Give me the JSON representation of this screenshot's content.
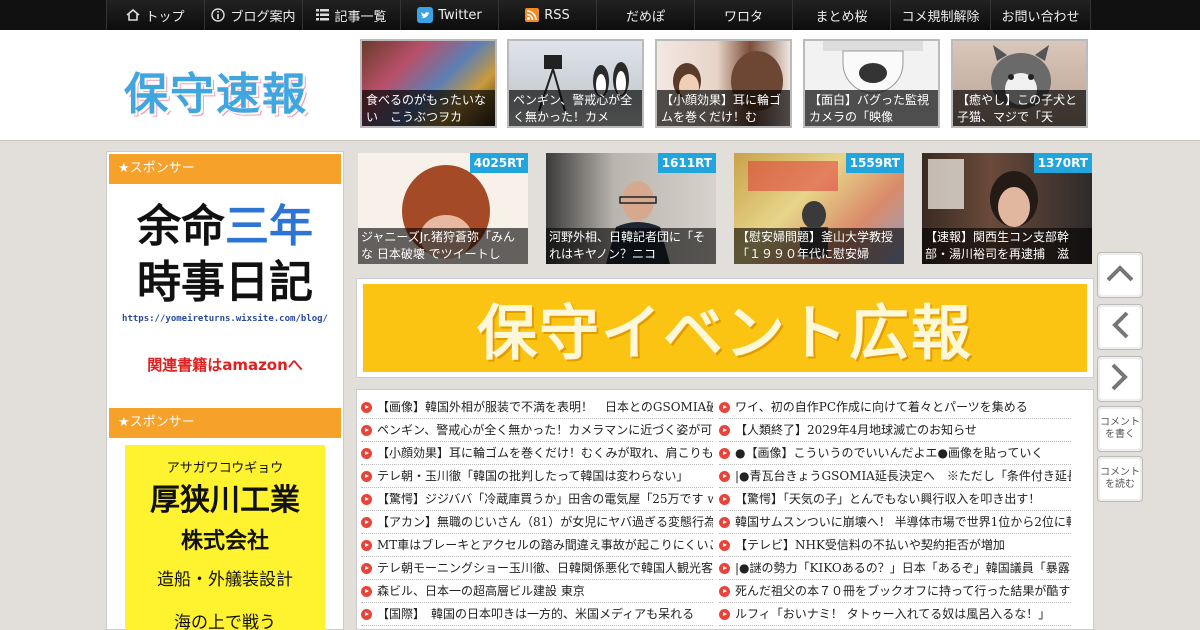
{
  "nav": {
    "items": [
      {
        "label": "トップ",
        "icon": "home-icon"
      },
      {
        "label": "ブログ案内",
        "icon": "info-icon"
      },
      {
        "label": "記事一覧",
        "icon": "list-icon"
      },
      {
        "label": "Twitter",
        "icon": "twitter-icon"
      },
      {
        "label": "RSS",
        "icon": "rss-icon"
      },
      {
        "label": "だめぽ"
      },
      {
        "label": "ワロタ"
      },
      {
        "label": "まとめ桜"
      },
      {
        "label": "コメ規制解除"
      },
      {
        "label": "お問い合わせ"
      }
    ]
  },
  "header": {
    "logo": "保守速報",
    "thumbs": [
      {
        "caption": "食べるのがもったいない　こうぶつヲカ"
      },
      {
        "caption": "ペンギン、警戒心が全く無かった！カメ"
      },
      {
        "caption": "【小顔効果】耳に輪ゴムを巻くだけ！む"
      },
      {
        "caption": "【面白】バグった監視カメラの「映像"
      },
      {
        "caption": "【癒やし】この子犬と子猫、マジで「天"
      }
    ]
  },
  "sidebar": {
    "sponsor_title": "★スポンサー",
    "ad1": {
      "line1a": "余命",
      "line1b": "三年",
      "line2": "時事日記",
      "url": "https://yomeireturns.wixsite.com/blog/",
      "amazon": "関連書籍はamazonへ"
    },
    "sponsor_title2": "★スポンサー",
    "ad2": {
      "kana": "アサガワコウギョウ",
      "name": "厚狭川工業",
      "company": "株式会社",
      "business": "造船・外艤装設計",
      "motto": "海の上で戦う"
    }
  },
  "rt_cards": [
    {
      "rt": "4025RT",
      "caption": "ジャニーズJr.猪狩蒼弥「みんな 日本破壊 でツイートし"
    },
    {
      "rt": "1611RT",
      "caption": "河野外相、日韓記者団に「それはキヤノン？ニコ"
    },
    {
      "rt": "1559RT",
      "caption": "【慰安婦問題】釜山大学教授 「１９９０年代に慰安婦"
    },
    {
      "rt": "1370RT",
      "caption": "【速報】関西生コン支部幹部・湯川裕司を再逮捕　滋"
    }
  ],
  "banner": {
    "text": "保守イベント広報"
  },
  "news": {
    "left": [
      "【画像】韓国外相が服装で不満を表明！　日本とのGSOMIA破",
      "ペンギン、警戒心が全く無かった！カメラマンに近づく姿が可",
      "【小顔効果】耳に輪ゴムを巻くだけ！むくみが取れ、肩こりも",
      "テレ朝・玉川徹「韓国の批判したって韓国は変わらない」",
      "【驚愕】ジジババ「冷蔵庫買うか」田舎の電気屋「25万です w",
      "【アカン】無職のじいさん（81）が女児にヤバ過ぎる変態行為",
      "MT車はブレーキとアクセルの踏み間違え事故が起こりにくいこ",
      "テレ朝モーニングショー玉川徹、日韓関係悪化で韓国人観光客",
      "森ビル、日本一の超高層ビル建設 東京",
      "【国際】　韓国の日本叩きは一方的、米国メディアも呆れる"
    ],
    "right": [
      "ワイ、初の自作PC作成に向けて着々とパーツを集める",
      "【人類終了】2029年4月地球滅亡のお知らせ",
      "●【画像】こういうのでいいんだよエ●画像を貼っていく",
      "|●青瓦台きょうGSOMIA延長決定へ　※ただし「条件付き延長",
      "【驚愕】「天気の子」とんでもない興行収入を叩き出す！",
      "韓国サムスンついに崩壊へ！ 半導体市場で世界1位から2位に転",
      "【テレビ】NHK受信料の不払いや契約拒否が増加",
      "|●謎の勢力「KIKOあるの？」日本「あるぞ」韓国議員「暴露",
      "死んだ祖父の本７０冊をブックオフに持って行った結果が酷す",
      "ルフィ「おいナミ！ タトゥー入れてる奴は風呂入るな！」"
    ]
  },
  "side_buttons": {
    "comment_write": "コメントを書く",
    "comment_read": "コメントを読む"
  }
}
